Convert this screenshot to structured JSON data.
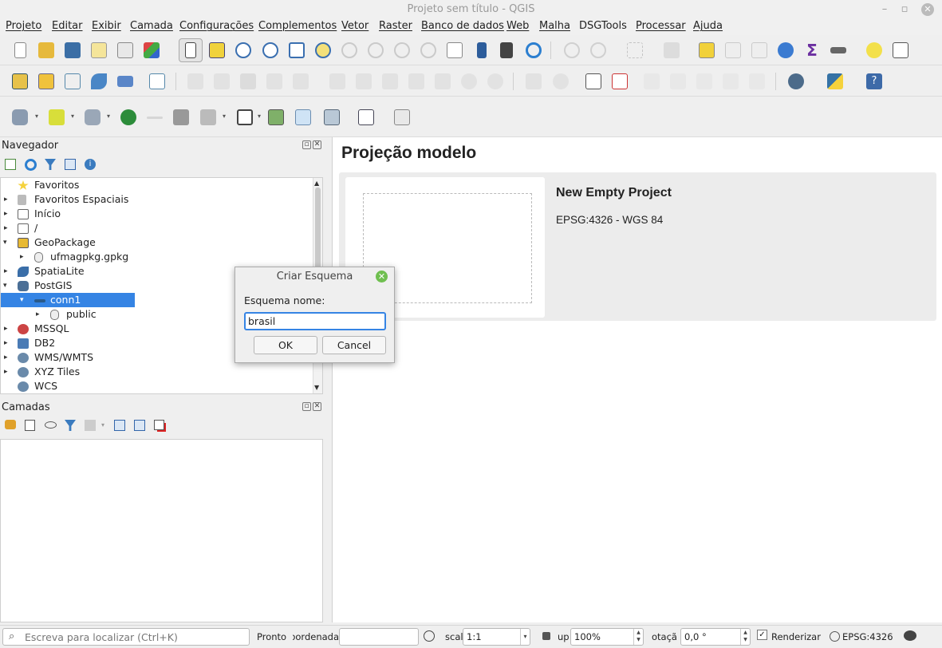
{
  "window": {
    "title": "Projeto sem título - QGIS"
  },
  "menu": [
    "Projeto",
    "Editar",
    "Exibir",
    "Camada",
    "Configurações",
    "Complementos",
    "Vetor",
    "Raster",
    "Banco de dados",
    "Web",
    "Malha",
    "DSGTools",
    "Processar",
    "Ajuda"
  ],
  "navigator": {
    "title": "Navegador",
    "items": [
      {
        "label": "Favoritos",
        "icon": "star-icon"
      },
      {
        "label": "Favoritos Espaciais",
        "icon": "spatial-bookmark-icon"
      },
      {
        "label": "Início",
        "icon": "home-folder-icon"
      },
      {
        "label": "/",
        "icon": "folder-icon"
      },
      {
        "label": "GeoPackage",
        "icon": "geopackage-icon"
      },
      {
        "label": "ufmagpkg.gpkg",
        "icon": "database-icon"
      },
      {
        "label": "SpatiaLite",
        "icon": "spatialite-icon"
      },
      {
        "label": "PostGIS",
        "icon": "postgis-icon"
      },
      {
        "label": "conn1",
        "icon": "connection-icon"
      },
      {
        "label": "public",
        "icon": "schema-icon"
      },
      {
        "label": "MSSQL",
        "icon": "mssql-icon"
      },
      {
        "label": "DB2",
        "icon": "db2-icon"
      },
      {
        "label": "WMS/WMTS",
        "icon": "globe-icon"
      },
      {
        "label": "XYZ Tiles",
        "icon": "globe-icon"
      },
      {
        "label": "WCS",
        "icon": "globe-icon"
      }
    ]
  },
  "layers": {
    "title": "Camadas"
  },
  "template": {
    "heading": "Projeção modelo",
    "card_name": "New Empty Project",
    "card_crs": "EPSG:4326 - WGS 84"
  },
  "dialog": {
    "title": "Criar Esquema",
    "label": "Esquema nome:",
    "value": "brasil",
    "ok": "OK",
    "cancel": "Cancel"
  },
  "status": {
    "search_placeholder": "Escreva para localizar (Ctrl+K)",
    "ready": "Pronto",
    "coord_label": "Coordenada",
    "coord_value": "",
    "scale_label": "scal",
    "scale_value": "1:1",
    "magnifier_label": "up",
    "magnifier_value": "100%",
    "rotation_label": "otaçã",
    "rotation_value": "0,0 °",
    "render_label": "Renderizar",
    "render_checked": true,
    "crs": "EPSG:4326"
  }
}
